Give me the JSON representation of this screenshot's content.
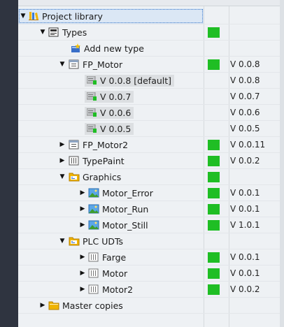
{
  "colors": {
    "status_green": "#1fbe24",
    "selection_outline": "#3a78c9",
    "sidebar_dark": "#2f3440"
  },
  "tree": {
    "root": {
      "label": "Project library",
      "icon": "project-library-icon",
      "expanded": true
    },
    "types": {
      "label": "Types",
      "icon": "types-folder-icon",
      "expanded": true,
      "status": "green"
    },
    "add_new_type": {
      "label": "Add new type",
      "icon": "add-new-type-icon"
    },
    "fp_motor": {
      "label": "FP_Motor",
      "icon": "function-block-icon",
      "expanded": true,
      "status": "green",
      "version": "V 0.0.8"
    },
    "fp_motor_versions": [
      {
        "label": "V 0.0.8 [default]",
        "version": "V 0.0.8"
      },
      {
        "label": "V 0.0.7",
        "version": "V 0.0.7"
      },
      {
        "label": "V 0.0.6",
        "version": "V 0.0.6"
      },
      {
        "label": "V 0.0.5",
        "version": "V 0.0.5"
      }
    ],
    "fp_motor2": {
      "label": "FP_Motor2",
      "icon": "function-block-icon",
      "expanded": false,
      "status": "green",
      "version": "V 0.0.11"
    },
    "typepaint": {
      "label": "TypePaint",
      "icon": "type-icon",
      "expanded": false,
      "status": "green",
      "version": "V 0.0.2"
    },
    "graphics": {
      "label": "Graphics",
      "icon": "folder-icon",
      "expanded": true,
      "status": "green"
    },
    "graphics_items": [
      {
        "label": "Motor_Error",
        "icon": "graphic-icon",
        "status": "green",
        "version": "V 0.0.1"
      },
      {
        "label": "Motor_Run",
        "icon": "graphic-icon",
        "status": "green",
        "version": "V 0.0.1"
      },
      {
        "label": "Motor_Still",
        "icon": "graphic-icon",
        "status": "green",
        "version": "V 1.0.1"
      }
    ],
    "plc_udts": {
      "label": "PLC UDTs",
      "icon": "folder-icon",
      "expanded": true
    },
    "udt_items": [
      {
        "label": "Farge",
        "icon": "udt-icon",
        "status": "green",
        "version": "V 0.0.1"
      },
      {
        "label": "Motor",
        "icon": "udt-icon",
        "status": "green",
        "version": "V 0.0.1"
      },
      {
        "label": "Motor2",
        "icon": "udt-icon",
        "status": "green",
        "version": "V 0.0.2"
      }
    ],
    "master_copies": {
      "label": "Master copies",
      "icon": "folder-icon",
      "expanded": false
    }
  }
}
